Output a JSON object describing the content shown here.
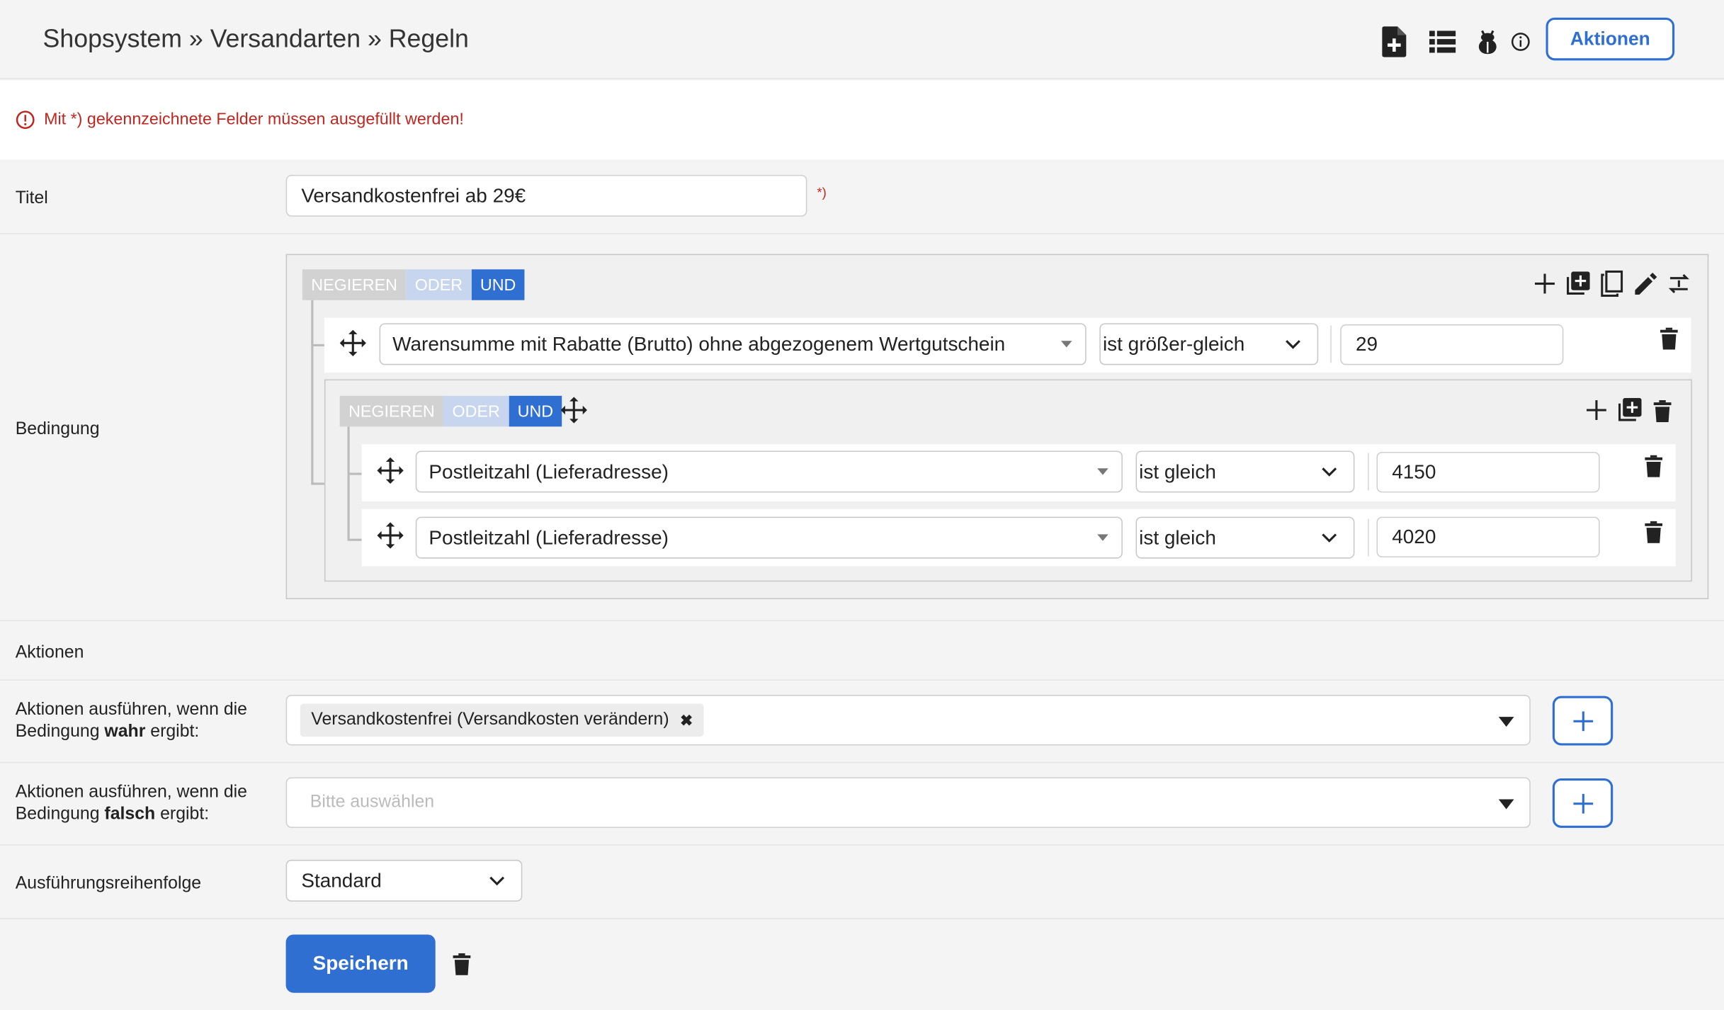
{
  "header": {
    "breadcrumb": "Shopsystem » Versandarten » Regeln",
    "icons": [
      "new-document-icon",
      "list-icon",
      "bug-icon",
      "info-icon"
    ],
    "actions_label": "Aktionen"
  },
  "notice": {
    "text": "Mit *) gekennzeichnete Felder müssen ausgefüllt werden!"
  },
  "form": {
    "title_label": "Titel",
    "title_value": "Versandkostenfrei ab 29€",
    "required_marker": "*)",
    "condition_label": "Bedingung",
    "actions_section_label": "Aktionen",
    "true_actions_label_pre": "Aktionen ausführen, wenn die Bedingung ",
    "true_actions_label_bold": "wahr",
    "true_actions_label_post": " ergibt:",
    "true_actions_tag": "Versandkostenfrei (Versandkosten verändern)",
    "false_actions_label_pre": "Aktionen ausführen, wenn die Bedingung ",
    "false_actions_label_bold": "falsch",
    "false_actions_label_post": " ergibt:",
    "false_actions_placeholder": "Bitte auswählen",
    "order_label": "Ausführungsreihenfolge",
    "order_value": "Standard",
    "save_label": "Speichern"
  },
  "condition": {
    "group": {
      "negate": "NEGIEREN",
      "or": "ODER",
      "and": "UND",
      "active": "UND",
      "rule": {
        "field": "Warensumme mit Rabatte (Brutto) ohne abgezogenem Wertgutschein",
        "operator": "ist größer-gleich",
        "value": "29"
      },
      "subgroup": {
        "negate": "NEGIEREN",
        "or": "ODER",
        "and": "UND",
        "active": "UND",
        "rules": [
          {
            "field": "Postleitzahl (Lieferadresse)",
            "operator": "ist gleich",
            "value": "4150"
          },
          {
            "field": "Postleitzahl (Lieferadresse)",
            "operator": "ist gleich",
            "value": "4020"
          }
        ]
      }
    }
  },
  "colors": {
    "accent": "#2f6fd1",
    "error": "#c0261f",
    "background": "#f4f4f4"
  }
}
